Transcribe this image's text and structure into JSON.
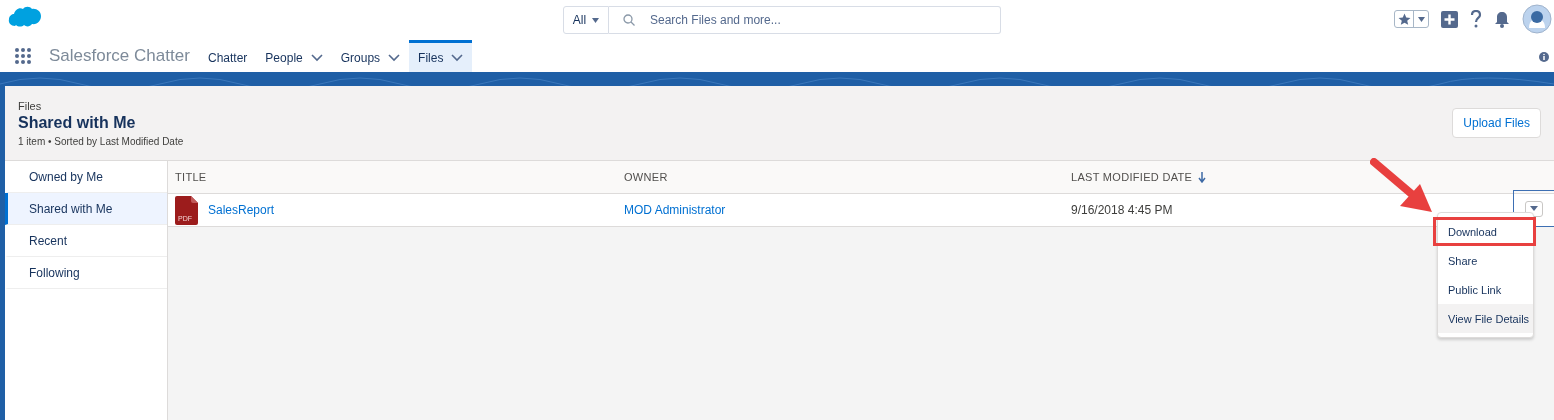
{
  "header": {
    "scope": "All",
    "search_placeholder": "Search Files and more..."
  },
  "nav": {
    "app_name": "Salesforce Chatter",
    "tabs": [
      {
        "label": "Chatter",
        "selected": false,
        "has_menu": false
      },
      {
        "label": "People",
        "selected": false,
        "has_menu": true
      },
      {
        "label": "Groups",
        "selected": false,
        "has_menu": true
      },
      {
        "label": "Files",
        "selected": true,
        "has_menu": true
      }
    ]
  },
  "page": {
    "breadcrumb": "Files",
    "title": "Shared with Me",
    "subtitle": "1 item • Sorted by Last Modified Date",
    "upload_button": "Upload Files"
  },
  "sidebar": {
    "items": [
      {
        "label": "Owned by Me",
        "selected": false
      },
      {
        "label": "Shared with Me",
        "selected": true
      },
      {
        "label": "Recent",
        "selected": false
      },
      {
        "label": "Following",
        "selected": false
      }
    ]
  },
  "table": {
    "columns": [
      {
        "label": "TITLE",
        "sorted": false
      },
      {
        "label": "OWNER",
        "sorted": false
      },
      {
        "label": "LAST MODIFIED DATE",
        "sorted": true
      }
    ],
    "rows": [
      {
        "file_type": "PDF",
        "title": "SalesReport",
        "owner": "MOD Administrator",
        "modified": "9/16/2018 4:45 PM",
        "menu_open": true
      }
    ]
  },
  "row_menu": {
    "items": [
      {
        "label": "Download",
        "hovered": false,
        "highlighted": true
      },
      {
        "label": "Share",
        "hovered": false,
        "highlighted": false
      },
      {
        "label": "Public Link",
        "hovered": false,
        "highlighted": false
      },
      {
        "label": "View File Details",
        "hovered": true,
        "highlighted": false
      }
    ]
  }
}
